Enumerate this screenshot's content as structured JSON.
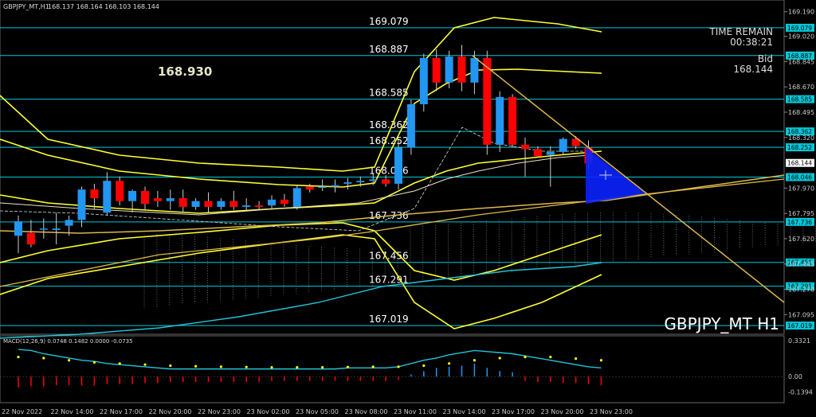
{
  "header": {
    "symbol": "GBPJPY_MT,H1",
    "ohlc": "168.137 168.164 168.103 168.144"
  },
  "timer": {
    "label": "TIME REMAIN",
    "value": "00:38:21"
  },
  "bid": {
    "label": "Bid",
    "value": "168.144"
  },
  "watermark": "GBPJPY_MT H1",
  "big_price": "168.930",
  "levels": [
    {
      "value": 169.079,
      "label": "169.079"
    },
    {
      "value": 168.887,
      "label": "168.887"
    },
    {
      "value": 168.585,
      "label": "168.585"
    },
    {
      "value": 168.362,
      "label": "168.362"
    },
    {
      "value": 168.252,
      "label": "168.252"
    },
    {
      "value": 168.046,
      "label": "168.046"
    },
    {
      "value": 167.736,
      "label": "167.736"
    },
    {
      "value": 167.456,
      "label": "167.456"
    },
    {
      "value": 167.291,
      "label": "167.291"
    },
    {
      "value": 167.019,
      "label": "167.019"
    }
  ],
  "current_price_tag": "168.144",
  "macd_label": "MACD(12,26,9) 0.0748 0.1482 0.0000 -0.0735",
  "colors": {
    "up": "#2196f3",
    "down": "#ff0000",
    "level": "#00c8d8",
    "band": "#ffff33",
    "macd": "#22c4d8",
    "signal": "#ffff00"
  },
  "chart_data": {
    "type": "candlestick",
    "ylim": [
      166.97,
      169.26
    ],
    "y_ticks": [
      "169.190",
      "169.020",
      "168.845",
      "168.670",
      "168.495",
      "168.320",
      "167.970",
      "167.795",
      "167.620",
      "167.445",
      "167.270",
      "167.095"
    ],
    "x_ticks": [
      "22 Nov 2022",
      "22 Nov 14:00",
      "22 Nov 17:00",
      "22 Nov 20:00",
      "22 Nov 23:00",
      "23 Nov 02:00",
      "23 Nov 05:00",
      "23 Nov 08:00",
      "23 Nov 11:00",
      "23 Nov 14:00",
      "23 Nov 17:00",
      "23 Nov 20:00",
      "23 Nov 23:00"
    ],
    "candles": [
      {
        "o": 167.64,
        "h": 167.78,
        "l": 167.52,
        "c": 167.74
      },
      {
        "o": 167.66,
        "h": 167.75,
        "l": 167.56,
        "c": 167.58
      },
      {
        "o": 167.69,
        "h": 167.76,
        "l": 167.62,
        "c": 167.69
      },
      {
        "o": 167.68,
        "h": 167.8,
        "l": 167.58,
        "c": 167.69
      },
      {
        "o": 167.71,
        "h": 167.78,
        "l": 167.64,
        "c": 167.75
      },
      {
        "o": 167.75,
        "h": 167.98,
        "l": 167.7,
        "c": 167.96
      },
      {
        "o": 167.96,
        "h": 168.0,
        "l": 167.82,
        "c": 167.9
      },
      {
        "o": 167.8,
        "h": 168.08,
        "l": 167.78,
        "c": 168.02
      },
      {
        "o": 168.02,
        "h": 168.05,
        "l": 167.85,
        "c": 167.88
      },
      {
        "o": 167.88,
        "h": 167.96,
        "l": 167.8,
        "c": 167.95
      },
      {
        "o": 167.95,
        "h": 167.98,
        "l": 167.82,
        "c": 167.86
      },
      {
        "o": 167.9,
        "h": 167.95,
        "l": 167.84,
        "c": 167.88
      },
      {
        "o": 167.88,
        "h": 167.96,
        "l": 167.82,
        "c": 167.9
      },
      {
        "o": 167.9,
        "h": 167.96,
        "l": 167.8,
        "c": 167.84
      },
      {
        "o": 167.84,
        "h": 167.9,
        "l": 167.82,
        "c": 167.88
      },
      {
        "o": 167.88,
        "h": 167.94,
        "l": 167.8,
        "c": 167.84
      },
      {
        "o": 167.84,
        "h": 167.9,
        "l": 167.82,
        "c": 167.88
      },
      {
        "o": 167.88,
        "h": 167.95,
        "l": 167.82,
        "c": 167.84
      },
      {
        "o": 167.84,
        "h": 167.9,
        "l": 167.82,
        "c": 167.85
      },
      {
        "o": 167.85,
        "h": 167.88,
        "l": 167.82,
        "c": 167.84
      },
      {
        "o": 167.85,
        "h": 167.92,
        "l": 167.83,
        "c": 167.89
      },
      {
        "o": 167.89,
        "h": 167.93,
        "l": 167.84,
        "c": 167.86
      },
      {
        "o": 167.84,
        "h": 167.99,
        "l": 167.82,
        "c": 167.97
      },
      {
        "o": 167.98,
        "h": 168.0,
        "l": 167.94,
        "c": 167.96
      },
      {
        "o": 167.98,
        "h": 168.03,
        "l": 167.95,
        "c": 167.98
      },
      {
        "o": 167.98,
        "h": 168.03,
        "l": 167.94,
        "c": 167.99
      },
      {
        "o": 168.0,
        "h": 168.04,
        "l": 167.96,
        "c": 168.01
      },
      {
        "o": 168.01,
        "h": 168.05,
        "l": 167.98,
        "c": 168.02
      },
      {
        "o": 168.02,
        "h": 168.07,
        "l": 167.99,
        "c": 168.03
      },
      {
        "o": 168.03,
        "h": 168.06,
        "l": 167.98,
        "c": 168.0
      },
      {
        "o": 168.0,
        "h": 168.3,
        "l": 167.96,
        "c": 168.25
      },
      {
        "o": 168.25,
        "h": 168.58,
        "l": 168.2,
        "c": 168.55
      },
      {
        "o": 168.55,
        "h": 168.9,
        "l": 168.5,
        "c": 168.87
      },
      {
        "o": 168.87,
        "h": 168.93,
        "l": 168.64,
        "c": 168.7
      },
      {
        "o": 168.7,
        "h": 168.92,
        "l": 168.66,
        "c": 168.88
      },
      {
        "o": 168.88,
        "h": 168.96,
        "l": 168.64,
        "c": 168.7
      },
      {
        "o": 168.7,
        "h": 168.92,
        "l": 168.62,
        "c": 168.87
      },
      {
        "o": 168.87,
        "h": 168.92,
        "l": 168.2,
        "c": 168.27
      },
      {
        "o": 168.27,
        "h": 168.64,
        "l": 168.22,
        "c": 168.6
      },
      {
        "o": 168.6,
        "h": 168.62,
        "l": 168.25,
        "c": 168.27
      },
      {
        "o": 168.27,
        "h": 168.32,
        "l": 168.05,
        "c": 168.24
      },
      {
        "o": 168.24,
        "h": 168.26,
        "l": 168.18,
        "c": 168.19
      },
      {
        "o": 168.2,
        "h": 168.26,
        "l": 167.98,
        "c": 168.22
      },
      {
        "o": 168.22,
        "h": 168.32,
        "l": 168.2,
        "c": 168.31
      },
      {
        "o": 168.31,
        "h": 168.33,
        "l": 168.24,
        "c": 168.26
      },
      {
        "o": 168.25,
        "h": 168.3,
        "l": 168.1,
        "c": 168.14
      }
    ],
    "macd": {
      "ylim": [
        -0.24,
        0.36
      ],
      "y_ticks": [
        "0.3321",
        "0.00",
        "-0.1394"
      ],
      "values": [
        0.25,
        0.24,
        0.21,
        0.19,
        0.17,
        0.15,
        0.14,
        0.12,
        0.11,
        0.1,
        0.09,
        0.08,
        0.07,
        0.07,
        0.07,
        0.07,
        0.07,
        0.07,
        0.07,
        0.07,
        0.07,
        0.07,
        0.07,
        0.07,
        0.07,
        0.07,
        0.08,
        0.08,
        0.08,
        0.08,
        0.09,
        0.12,
        0.15,
        0.17,
        0.2,
        0.22,
        0.24,
        0.23,
        0.22,
        0.21,
        0.19,
        0.17,
        0.15,
        0.13,
        0.11,
        0.09,
        0.08
      ],
      "signal": [
        0.18,
        0.175,
        0.17,
        0.16,
        0.15,
        0.14,
        0.13,
        0.125,
        0.12,
        0.115,
        0.11,
        0.105,
        0.1,
        0.1,
        0.095,
        0.09,
        0.09,
        0.09,
        0.088,
        0.085,
        0.085,
        0.085,
        0.085,
        0.085,
        0.085,
        0.085,
        0.088,
        0.09,
        0.09,
        0.09,
        0.09,
        0.095,
        0.1,
        0.11,
        0.12,
        0.14,
        0.15,
        0.16,
        0.17,
        0.175,
        0.18,
        0.18,
        0.18,
        0.17,
        0.165,
        0.16,
        0.15
      ],
      "hist": [
        -0.1,
        -0.09,
        -0.09,
        -0.08,
        -0.08,
        -0.08,
        -0.08,
        -0.07,
        -0.07,
        -0.07,
        -0.06,
        -0.06,
        -0.05,
        -0.05,
        -0.05,
        -0.05,
        -0.05,
        -0.05,
        -0.05,
        -0.05,
        -0.04,
        -0.04,
        -0.04,
        -0.04,
        -0.04,
        -0.04,
        -0.04,
        -0.04,
        -0.04,
        -0.04,
        -0.03,
        0.02,
        0.05,
        0.08,
        0.09,
        0.1,
        0.12,
        0.08,
        0.05,
        0.04,
        -0.04,
        -0.05,
        -0.05,
        -0.06,
        -0.06,
        -0.07,
        -0.08
      ]
    }
  }
}
